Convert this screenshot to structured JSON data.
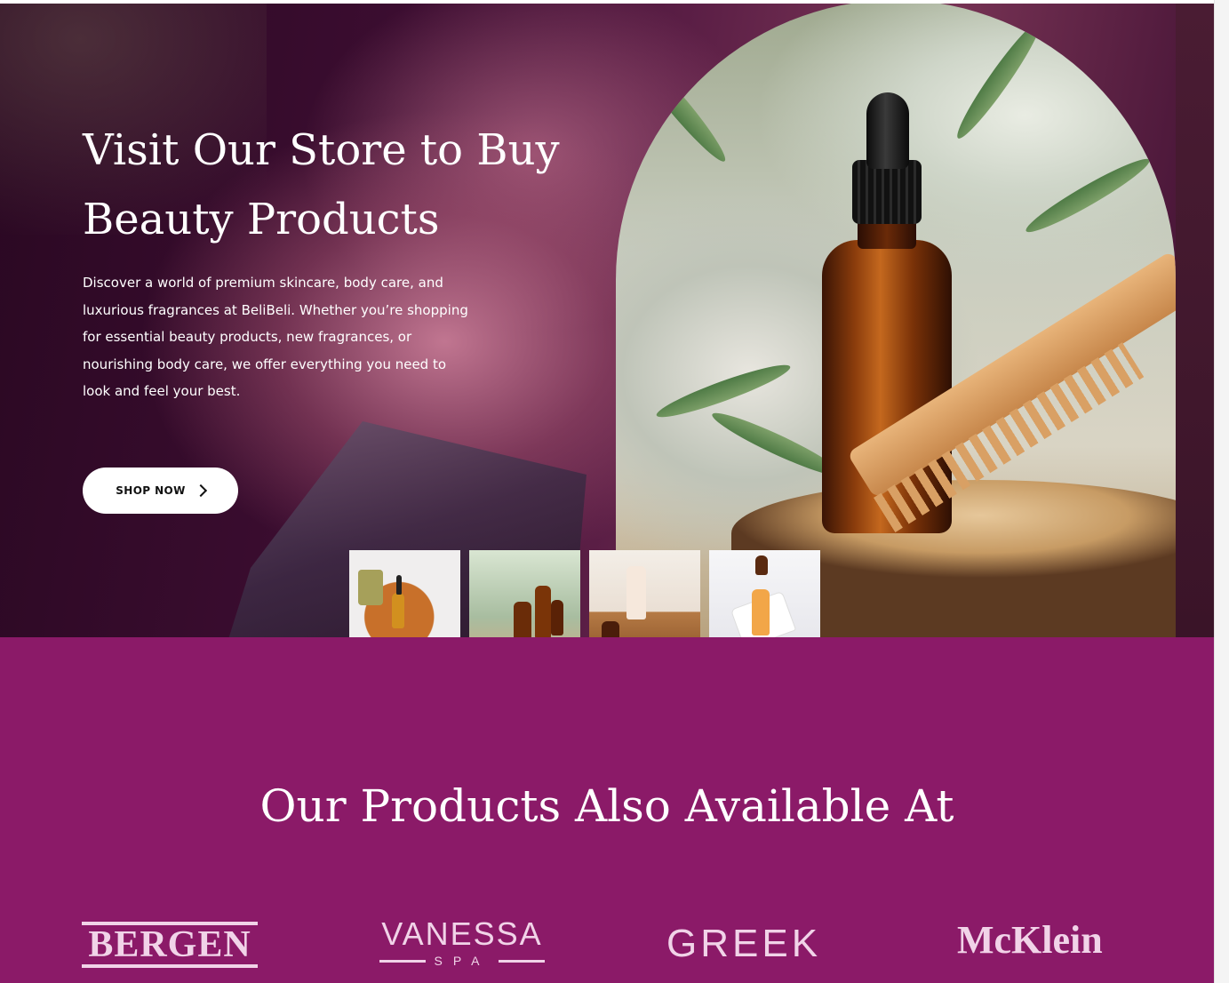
{
  "hero": {
    "title_line1": "Visit Our Store to Buy",
    "title_line2": "Beauty Products",
    "description": "Discover a world of premium skincare, body care, and luxurious fragrances at BeliBeli. Whether you’re shopping for essential beauty products, new fragrances, or nourishing body care, we offer everything you need to look and feel your best.",
    "button_label": "SHOP NOW",
    "button_icon": "chevron-right-icon",
    "thumbnails": [
      "serum-on-wooden-tray",
      "amber-dropper-bottles",
      "cream-bottles-on-stone",
      "white-bottle-on-block"
    ]
  },
  "partners": {
    "title": "Our Products Also Available At",
    "logos": {
      "bergen": "BERGEN",
      "vanessa": "VANESSA",
      "vanessa_sub": "SPA",
      "greek": "GREEK",
      "mcklein": "McKlein"
    }
  },
  "colors": {
    "partners_bg": "#8b1a68",
    "hero_dark": "#3b0d30",
    "logo_tint": "#f1d3e8",
    "button_bg": "#ffffff"
  }
}
